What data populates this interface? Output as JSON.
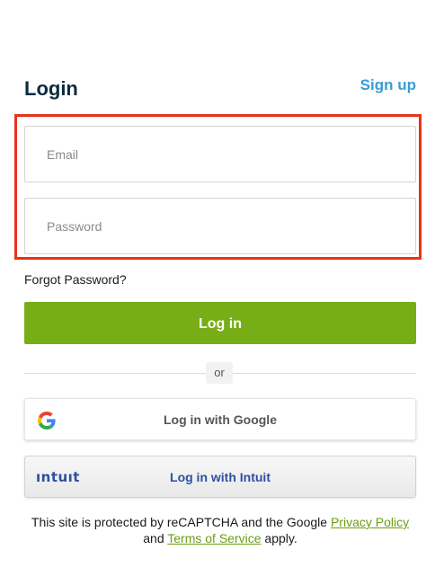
{
  "header": {
    "title": "Login",
    "signup_label": "Sign up"
  },
  "form": {
    "email_placeholder": "Email",
    "password_placeholder": "Password",
    "forgot_label": "Forgot Password?",
    "login_label": "Log in",
    "divider_label": "or"
  },
  "social": {
    "google_label": "Log in with Google",
    "google_icon": "google-g-icon",
    "intuit_label": "Log in with Intuit",
    "intuit_logo_text": "ıntuıt"
  },
  "footer": {
    "text_before": "This site is protected by reCAPTCHA and the Google ",
    "privacy_label": "Privacy Policy",
    "text_middle": " and ",
    "terms_label": "Terms of Service",
    "text_after": " apply."
  },
  "colors": {
    "title": "#0d2b3e",
    "signup": "#3a9bd5",
    "login_button": "#77ad17",
    "highlight_border": "#e8321c",
    "intuit_blue": "#2d4fa0",
    "link_green": "#6a9e10"
  }
}
